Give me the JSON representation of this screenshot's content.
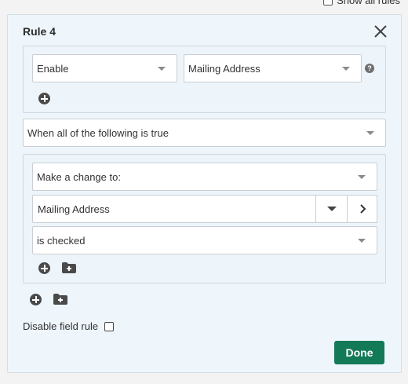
{
  "header": {
    "show_all_label": "Show all rules"
  },
  "rule": {
    "title": "Rule 4",
    "action": {
      "value": "Enable"
    },
    "target_field": {
      "value": "Mailing Address"
    },
    "help_glyph": "?",
    "condition_mode": {
      "value": "When all of the following is true"
    },
    "condition": {
      "change_type": {
        "value": "Make a change to:"
      },
      "field": {
        "value": "Mailing Address"
      },
      "state": {
        "value": "is checked"
      }
    },
    "disable_label": "Disable field rule",
    "done_label": "Done"
  },
  "icons": {
    "close": "close-icon",
    "add": "plus-circle-icon",
    "add_group": "folder-plus-icon",
    "caret": "caret-down-icon",
    "chevron": "chevron-right-icon"
  },
  "colors": {
    "panel_bg": "#eef5fb",
    "done_bg": "#137a58",
    "icon_dark": "#4a4a4a"
  }
}
